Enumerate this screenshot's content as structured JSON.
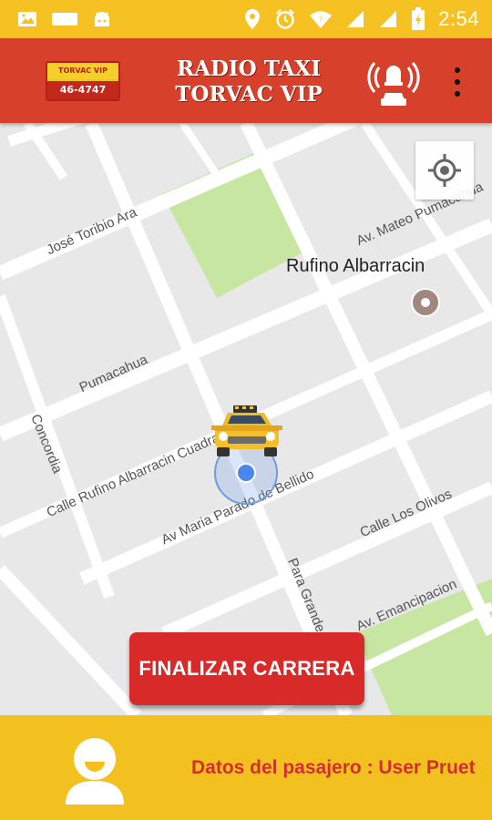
{
  "status_bar": {
    "time": "2:54",
    "left_icons": [
      "image-icon",
      "sd-card-icon",
      "android-icon"
    ],
    "right_icons": [
      "location-icon",
      "alarm-icon",
      "wifi-icon",
      "signal-icon",
      "signal-icon",
      "battery-charging-icon"
    ],
    "background": "#f6c122"
  },
  "app_bar": {
    "title_line1": "RADIO TAXI",
    "title_line2": "TORVAC VIP",
    "logo_phone": "46-4747",
    "background": "#d7402a",
    "actions": [
      "alarm-taxi-icon",
      "overflow-menu-icon"
    ]
  },
  "map": {
    "streets": [
      "José Toribio Ara",
      "Av. Mateo Pumacahua",
      "Pumacahua",
      "Concordia",
      "Calle Rufino Albarracin Cuadra",
      "Av Maria Parado de Bellido",
      "Calle Los Olivos",
      "Para Grande",
      "Av. Emancipacion"
    ],
    "poi": "Rufino Albarracin",
    "finish_button": "FINALIZAR CARRERA",
    "colors": {
      "road": "#ffffff",
      "block": "#e8e8e8",
      "park": "#c6e6a2",
      "button": "#d92a2a"
    }
  },
  "bottom_bar": {
    "passenger_text": "Datos del pasajero : User Pruet",
    "background": "#f2c11f"
  }
}
